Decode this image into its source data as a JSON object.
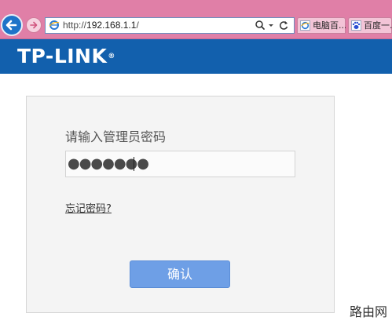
{
  "browser": {
    "url_prefix": "http://",
    "url_host": "192.168.1.1",
    "url_suffix": "/",
    "tabs": [
      {
        "label": "电脑百...",
        "icon": "ie-page-icon"
      },
      {
        "label": "百度一...",
        "icon": "baidu-paw-icon"
      }
    ],
    "icons": {
      "back": "back-arrow-icon",
      "forward": "forward-arrow-icon",
      "search": "search-icon",
      "dropdown": "chevron-down-icon",
      "refresh": "refresh-icon"
    }
  },
  "header": {
    "logo_text": "TP-LINK",
    "logo_mark": "®"
  },
  "login": {
    "password_label": "请输入管理员密码",
    "password_value": "●●●●●●●",
    "forgot_link": "忘记密码?",
    "confirm_label": "确认"
  },
  "watermark": "路由网",
  "colors": {
    "browser_chrome": "#e07fa7",
    "brand_blue": "#1260ad",
    "button_blue": "#6e9fe6",
    "card_bg": "#f4f4f4"
  }
}
